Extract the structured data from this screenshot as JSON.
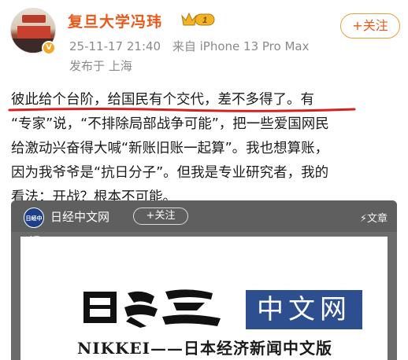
{
  "header": {
    "username": "复旦大学冯玮",
    "badge_text": "1",
    "datetime": "25-11-17 21:40",
    "source": "来自 iPhone 13 Pro Max",
    "location": "发布于 上海",
    "follow_label": "+关注"
  },
  "post": {
    "line1_underlined": "彼此给个台阶，给国民有个交代，差不多得了。",
    "line1_rest": "有",
    "line2": "“专家”说，“不排除局部战争可能”，把一些爱国网民",
    "line3": "给激动兴奋得大喊“新账旧账一起算”。我也想算账，",
    "line4": "因为我爷爷是“抗日分子”。但我是专业研究者，我的",
    "line5": "看法：开战？根本不可能。"
  },
  "card": {
    "logo_text": "日经中文网",
    "name": "日经中文网",
    "follow_label": "+关注",
    "tag": "⚡文章",
    "brand_cn": "中文网",
    "brand_en": "NIKKEI——日本经济新闻中文版"
  },
  "colors": {
    "username": "#e8591a",
    "accent_border": "#e8a03a",
    "underline": "#d81e1e",
    "nikkei_blue": "#2d4f8f"
  }
}
